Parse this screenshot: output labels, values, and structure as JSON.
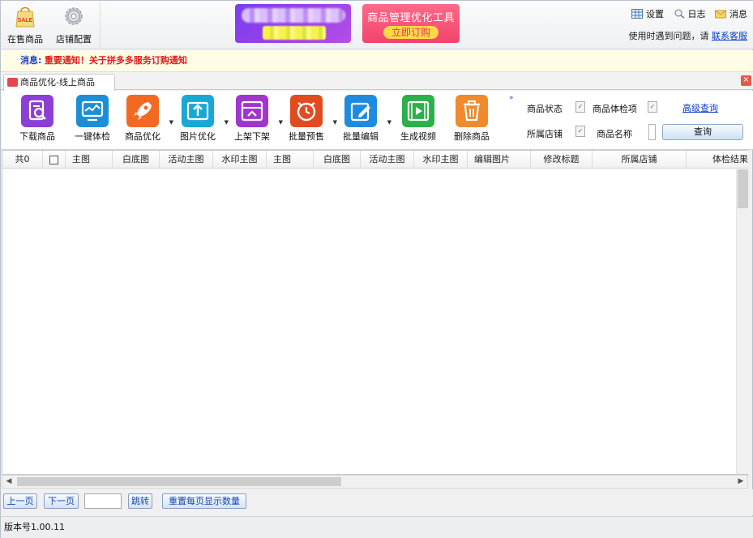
{
  "top_nav": {
    "on_sale_label": "在售商品",
    "store_config_label": "店铺配置",
    "sale_icon_text": "SALE"
  },
  "ads": {
    "promo_title": "商品管理优化工具",
    "promo_button": "立即订购"
  },
  "top_right": {
    "settings": "设置",
    "log": "日志",
    "messages": "消息",
    "help_text": "使用时遇到问题，请",
    "contact_link": "联系客服"
  },
  "notice": {
    "label": "消息:",
    "message": "重要通知！关于拼多多服务订购通知"
  },
  "tab": {
    "title": "商品优化-线上商品"
  },
  "toolbar": {
    "items": [
      {
        "label": "下载商品",
        "icon": "download-doc-icon",
        "color": "#8c3fd6"
      },
      {
        "label": "一键体检",
        "icon": "monitor-icon",
        "color": "#1a8fd8"
      },
      {
        "label": "商品优化",
        "icon": "rocket-icon",
        "color": "#f26a21"
      },
      {
        "label": "图片优化",
        "icon": "image-upload-icon",
        "color": "#18a8d6"
      },
      {
        "label": "上架下架",
        "icon": "shelf-icon",
        "color": "#a234d0"
      },
      {
        "label": "批量预售",
        "icon": "alarm-clock-icon",
        "color": "#e24a1f"
      },
      {
        "label": "批量编辑",
        "icon": "edit-icon",
        "color": "#1f8be0"
      },
      {
        "label": "生成视频",
        "icon": "video-icon",
        "color": "#2bb04a"
      },
      {
        "label": "删除商品",
        "icon": "trash-icon",
        "color": "#f08a2a"
      }
    ],
    "more": "»"
  },
  "filters": {
    "status_label": "商品状态",
    "health_label": "商品体检项",
    "advanced_link": "高级查询",
    "store_label": "所属店铺",
    "name_label": "商品名称",
    "query_button": "查询",
    "check_mark": "✓"
  },
  "grid": {
    "columns": [
      "共0",
      "",
      "主图",
      "白底图",
      "活动主图",
      "水印主图",
      "主图",
      "白底图",
      "活动主图",
      "水印主图",
      "编辑图片",
      "修改标题",
      "所属店铺",
      "体检结果"
    ],
    "rows": []
  },
  "pager": {
    "prev": "上一页",
    "next": "下一页",
    "jump": "跳转",
    "reset_page_size": "重置每页显示数量"
  },
  "status": {
    "version": "版本号1.00.11"
  }
}
